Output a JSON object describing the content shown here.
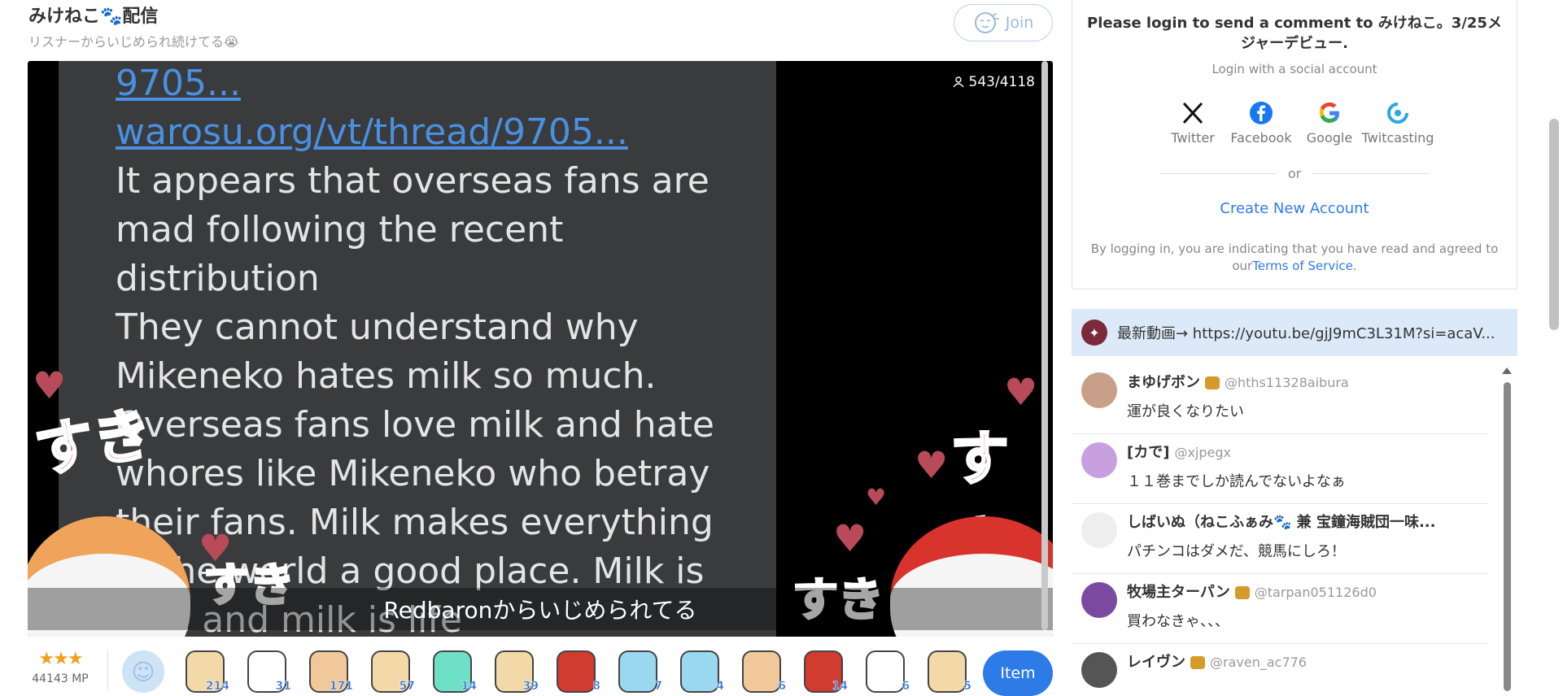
{
  "stream": {
    "title": "みけねこ🐾配信",
    "subtitle": "リスナーからいじめられ続けてる😭",
    "join_label": "Join",
    "viewers": "543/4118",
    "caption": "Redbaronからいじめられてる",
    "video_lines": [
      "9705...",
      "warosu.org/vt/thread/9705...",
      "It appears that overseas fans are",
      "mad following the recent",
      "distribution",
      "They cannot understand why",
      "Mikeneko hates milk so much.",
      "Overseas fans love milk and hate",
      "whores like Mikeneko who betray",
      "their fans. Milk makes everything",
      "in the world a good place. Milk is",
      "love and milk is life"
    ],
    "suki": "すき"
  },
  "bottom": {
    "rank_stars": "★★★",
    "mp": "44143 MP",
    "item_label": "Item",
    "gifts": [
      {
        "count": "214",
        "color": "#f3d9a8"
      },
      {
        "count": "31",
        "color": "#ffffff"
      },
      {
        "count": "171",
        "color": "#f0c89a"
      },
      {
        "count": "57",
        "color": "#f3d9a8"
      },
      {
        "count": "14",
        "color": "#6fe0c8"
      },
      {
        "count": "39",
        "color": "#f3d9a8"
      },
      {
        "count": "8",
        "color": "#d23b2f"
      },
      {
        "count": "7",
        "color": "#9ad8f0"
      },
      {
        "count": "4",
        "color": "#9ad8f0"
      },
      {
        "count": "6",
        "color": "#f0c89a"
      },
      {
        "count": "14",
        "color": "#d23b2f"
      },
      {
        "count": "6",
        "color": "#ffffff"
      },
      {
        "count": "5",
        "color": "#f3d9a8"
      }
    ]
  },
  "login": {
    "title": "Please login to send a comment to みけねこ。3/25メジャーデビュー.",
    "subtitle": "Login with a social account",
    "providers": [
      "Twitter",
      "Facebook",
      "Google",
      "Twitcasting"
    ],
    "or": "or",
    "create_account": "Create New Account",
    "terms_prefix": "By logging in, you are indicating that you have read and agreed to our",
    "terms_link": "Terms of Service",
    "terms_suffix": "."
  },
  "pinned": {
    "text": "最新動画→ https://youtu.be/gjJ9mC3L31M?si=acaV..."
  },
  "comments": [
    {
      "name": "まゆげボン",
      "handle": "@hths11328aibura",
      "text": "運が良くなりたい",
      "avatar_color": "#c8a08a"
    },
    {
      "name": "[カで]",
      "handle": "@xjpegx",
      "text": "１１巻までしか読んでないよなぁ",
      "avatar_color": "#c8a0e0"
    },
    {
      "name": "しばいぬ（ねこふぁみ🐾 兼 宝鐘海賊団一味...",
      "handle": "",
      "text": "パチンコはダメだ、競馬にしろ！",
      "avatar_color": "#eeeeee"
    },
    {
      "name": "牧場主ターパン",
      "handle": "@tarpan051126d0",
      "text": "買わなきゃ、、、",
      "avatar_color": "#7a4aa0"
    },
    {
      "name": "レイヴン",
      "handle": "@raven_ac776",
      "text": "",
      "avatar_color": "#555555"
    }
  ]
}
